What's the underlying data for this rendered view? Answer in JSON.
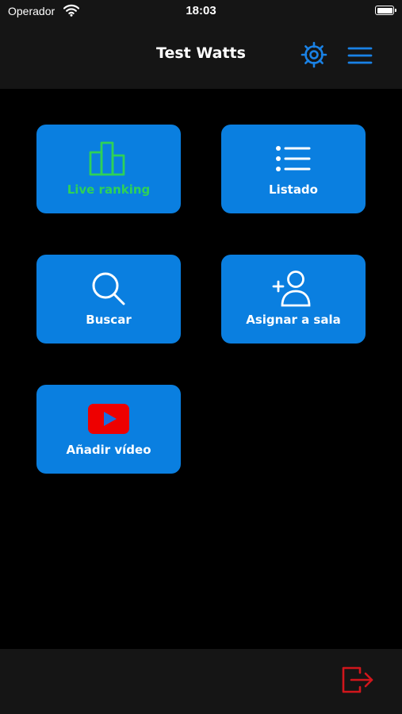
{
  "status_bar": {
    "carrier": "Operador",
    "time": "18:03"
  },
  "header": {
    "title": "Test Watts",
    "icons": [
      "gear-icon",
      "hamburger-menu-icon"
    ]
  },
  "tiles": [
    {
      "label": "Live ranking",
      "icon": "bar-chart-icon",
      "label_color": "#2ed158"
    },
    {
      "label": "Listado",
      "icon": "list-icon"
    },
    {
      "label": "Buscar",
      "icon": "search-icon"
    },
    {
      "label": "Asignar a sala",
      "icon": "add-user-icon"
    },
    {
      "label": "Añadir vídeo",
      "icon": "youtube-play-icon"
    }
  ],
  "footer": {
    "icon": "logout-icon"
  },
  "colors": {
    "accent": "#1a82e6",
    "tile_background": "#0a7fe0",
    "live_green": "#2ed158",
    "logout_red": "#d0161c",
    "youtube_red": "#ee0000",
    "bar_background": "#151515"
  }
}
